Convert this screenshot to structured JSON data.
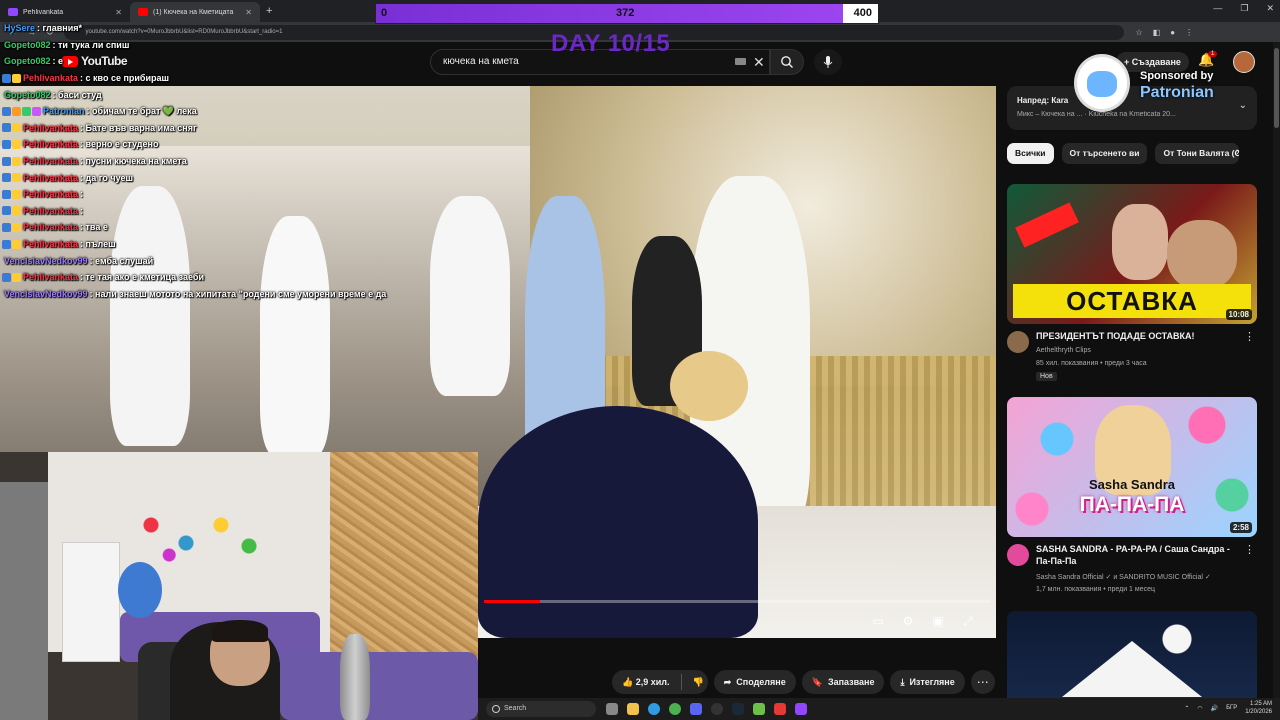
{
  "browser": {
    "tabs": [
      {
        "label": "Pehlivankata"
      },
      {
        "label": "(1) Кючека на Кметицата"
      }
    ],
    "url": "youtube.com/watch?v=0MuroJbbrbU&list=RD0MuroJbbrbU&start_radio=1"
  },
  "stream": {
    "goal_min": "0",
    "goal_current": "372",
    "goal_max": "400",
    "goal_progress": 0.93,
    "day_label": "DAY 10/15",
    "sponsor_by": "Sponsored by",
    "sponsor_name": "Patronian"
  },
  "chat": [
    {
      "user": "HySere",
      "color": "#3aa0ff",
      "msg": ": главния*",
      "badges": []
    },
    {
      "user": "Gopeto082",
      "color": "#33cc66",
      "msg": ": ти тука ли спиш",
      "badges": []
    },
    {
      "user": "Gopeto082",
      "color": "#33cc66",
      "msg": ": е",
      "badges": []
    },
    {
      "user": "Pehlivankata",
      "color": "#ff3344",
      "msg": ": с кво се прибираш",
      "badges": [
        "#3a7bd5",
        "#ffcc33"
      ]
    },
    {
      "user": "Gopeto082",
      "color": "#33cc66",
      "msg": ": баси студ",
      "badges": []
    },
    {
      "user": "Patronian",
      "color": "#3aa0ff",
      "msg": ": обичам те брат 💚 лека",
      "badges": [
        "#3a7bd5",
        "#ff9922",
        "#33cc66",
        "#cc55ff"
      ]
    },
    {
      "user": "Pehlivankata",
      "color": "#ff3344",
      "msg": ": Бате във варна има сняг",
      "badges": [
        "#3a7bd5",
        "#ffcc33"
      ]
    },
    {
      "user": "Pehlivankata",
      "color": "#ff3344",
      "msg": ": верно е студено",
      "badges": [
        "#3a7bd5",
        "#ffcc33"
      ]
    },
    {
      "user": "Pehlivankata",
      "color": "#ff3344",
      "msg": ": пусни кючека на кмета",
      "badges": [
        "#3a7bd5",
        "#ffcc33"
      ]
    },
    {
      "user": "Pehlivankata",
      "color": "#ff3344",
      "msg": ": да го чуеш",
      "badges": [
        "#3a7bd5",
        "#ffcc33"
      ]
    },
    {
      "user": "Pehlivankata",
      "color": "#ff3344",
      "msg": ":",
      "badges": [
        "#3a7bd5",
        "#ffcc33"
      ]
    },
    {
      "user": "Pehlivankata",
      "color": "#ff3344",
      "msg": ":",
      "badges": [
        "#3a7bd5",
        "#ffcc33"
      ]
    },
    {
      "user": "Pehlivankata",
      "color": "#ff3344",
      "msg": ": тва е",
      "badges": [
        "#3a7bd5",
        "#ffcc33"
      ]
    },
    {
      "user": "Pehlivankata",
      "color": "#ff3344",
      "msg": ": пълеш",
      "badges": [
        "#3a7bd5",
        "#ffcc33"
      ]
    },
    {
      "user": "VenclslavNedkov99",
      "color": "#9b7bff",
      "msg": ": емба слушай",
      "badges": []
    },
    {
      "user": "Pehlivankata",
      "color": "#ff3344",
      "msg": ": те тая ако е кметица заеби",
      "badges": [
        "#3a7bd5",
        "#ffcc33"
      ]
    },
    {
      "user": "VenclslavNedkov99",
      "color": "#9b7bff",
      "msg": ": нали знаеш мотото на хипитата \"родени сме уморени време е да",
      "badges": []
    }
  ],
  "youtube": {
    "logo_text": "YouTube",
    "search_value": "кючека на кмета",
    "create_label": "Създаване",
    "notif_count": "1",
    "playlist": {
      "title": "Напред: Кara",
      "subtitle": "Микс – Кючека на ... · Kiucheka na Kmeticata 20..."
    },
    "chips": [
      "Всички",
      "От търсенето ви",
      "От Тони Валята (С"
    ],
    "actions": {
      "likes": "2,9 хил.",
      "share": "Споделяне",
      "save": "Запазване",
      "download": "Изтегляне"
    },
    "videos": [
      {
        "title": "ПРЕЗИДЕНТЪТ ПОДАДЕ ОСТАВКА!",
        "channel": "Aethelthryth Clips",
        "meta": "85 хил. показвания • преди 3 часа",
        "badge": "Нов",
        "duration": "10:08",
        "thumb_text": "ОСТАВКА",
        "avatar_color": "#8a6a4a"
      },
      {
        "title": "SASHA SANDRA - PA-PA-PA / Саша Сандра - Па-Па-Па",
        "channel": "Sasha Sandra Official ✓ и SANDRITO MUSIC Official ✓",
        "meta": "1,7 млн. показвания • преди 1 месец",
        "duration": "2:58",
        "thumb_artist": "Sasha Sandra",
        "thumb_song": "ПА-ПА-ПА",
        "avatar_color": "#e44a9c"
      }
    ]
  },
  "taskbar": {
    "search_placeholder": "Search",
    "lang": "БГР",
    "time": "1:25 AM",
    "date": "1/20/2026"
  },
  "colors": {
    "accent_red": "#ff0000",
    "goal_purple": "#7a2fd6",
    "day_purple": "#6b28c9"
  }
}
